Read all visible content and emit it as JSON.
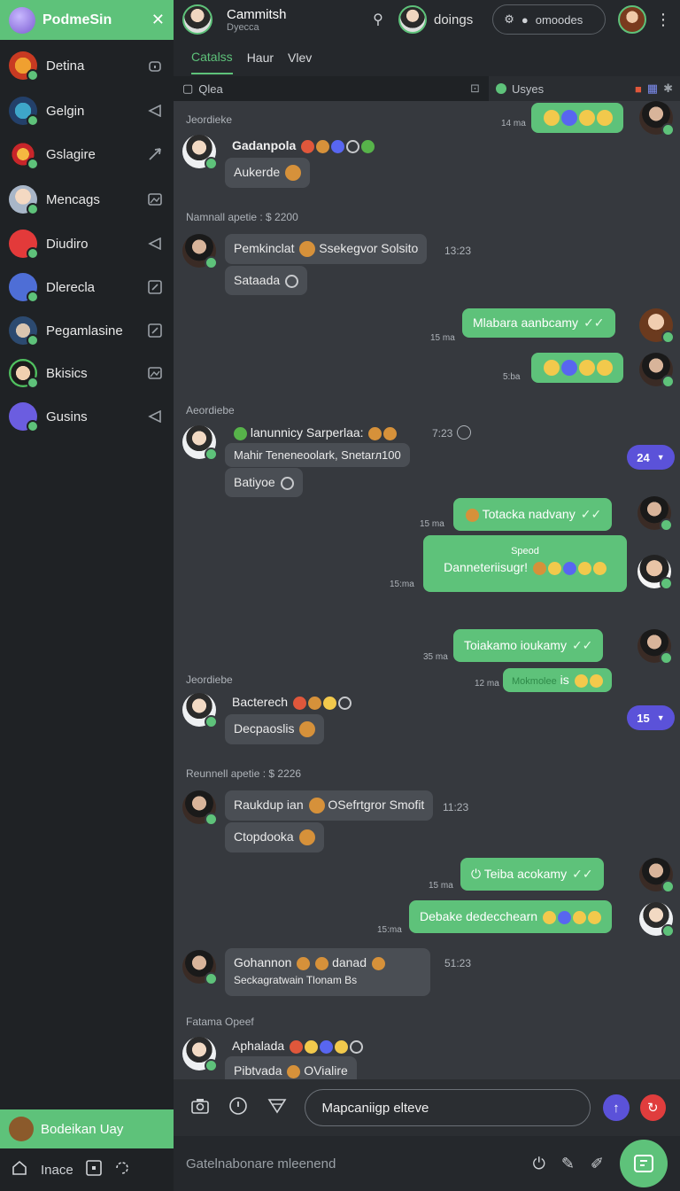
{
  "sidebar": {
    "app_title": "PodmeSin",
    "close": "✕",
    "items": [
      {
        "label": "Detina"
      },
      {
        "label": "Gelgin"
      },
      {
        "label": "Gslagire"
      },
      {
        "label": "Mencags"
      },
      {
        "label": "Diudiro"
      },
      {
        "label": "Dlerecla"
      },
      {
        "label": "Pegamlasine"
      },
      {
        "label": "Bkisics"
      },
      {
        "label": "Gusins"
      }
    ],
    "footer_user": "Bodeikan Uay",
    "bottom_label": "Inace"
  },
  "header": {
    "title": "Cammitsh",
    "subtitle": "Dyecca",
    "doings": "doings",
    "pill_label": "omoodes",
    "tabs": [
      "Catalss",
      "Haur",
      "Vlev"
    ]
  },
  "subbar": {
    "left_label": "Qlea",
    "right_label": "Usyes"
  },
  "chat": {
    "sections": [
      "Jeordieke",
      "Namnall apetie : $ 2200",
      "Aeordiebe",
      "Jeordiebe",
      "Reunnell apetie : $ 2226",
      "Fatama Opeef"
    ],
    "messages": {
      "m1_time": "14 ma",
      "gadanpola_name": "Gadanpola",
      "gadanpola_text": "Aukerde",
      "pemkinclat_text": "Pemkinclat",
      "pemkinclat_extra": "Ssekegvor Solsito",
      "pemkinclat_time": "13:23",
      "satsada_text": "Sataada",
      "mabara_text": "Mlabara aanbcamy",
      "mabara_time": "15 ma",
      "emoji_time": "5:ba",
      "lanunniey_name": "lanunnicy Sarperlaa:",
      "lanunniey_time": "7:23",
      "tenersoolark_text": "Mahir Teneneoolark, Snetarл100",
      "batiyoe_text": "Batiyoe",
      "badge1": "24",
      "totacka_text": "Totacka nadvany",
      "totacka_time": "15 ma",
      "speed_label": "Speod",
      "danneterisugn_text": "Danneteriisugr!",
      "danneterisugn_time": "15:ma",
      "toiakamo_text": "Toiakamo ioukamy",
      "toiakamo_time": "35 ma",
      "blurred_label": "Mokmolee",
      "blurred_suffix": "is",
      "blurred_time": "12 ma",
      "bacterech_name": "Bacterech",
      "decpaoslis_text": "Decpaoslis",
      "badge2": "15",
      "raukdup_text": "Raukdup ian",
      "raukdup_extra": "OSefrtgror Smofit",
      "raukdup_time": "11:23",
      "ctopdooka_text": "Ctopdooka",
      "teiba_text": "Teiba acokamy",
      "teiba_time": "15 ma",
      "debake_text": "Debake dedecchearn",
      "debake_time": "15:ma",
      "gohannon_name": "Gohannon",
      "gohannon_extra": "danad",
      "gohannon_time": "51:23",
      "gohannon_text": "Seckagratwain Tlonam Bs",
      "aphalada_name": "Aphalada",
      "pibtvada_text": "Pibtvada",
      "ovialire_text": "OVialire"
    }
  },
  "composer": {
    "input_value": "Mapcaniigp elteve",
    "hint": "Gatelnabonare mleenend"
  },
  "colors": {
    "accent": "#5ec27a",
    "badge": "#5b52d9",
    "record": "#e03d3d",
    "chat_bg": "#36393e",
    "sidebar_bg": "#1f2225"
  }
}
